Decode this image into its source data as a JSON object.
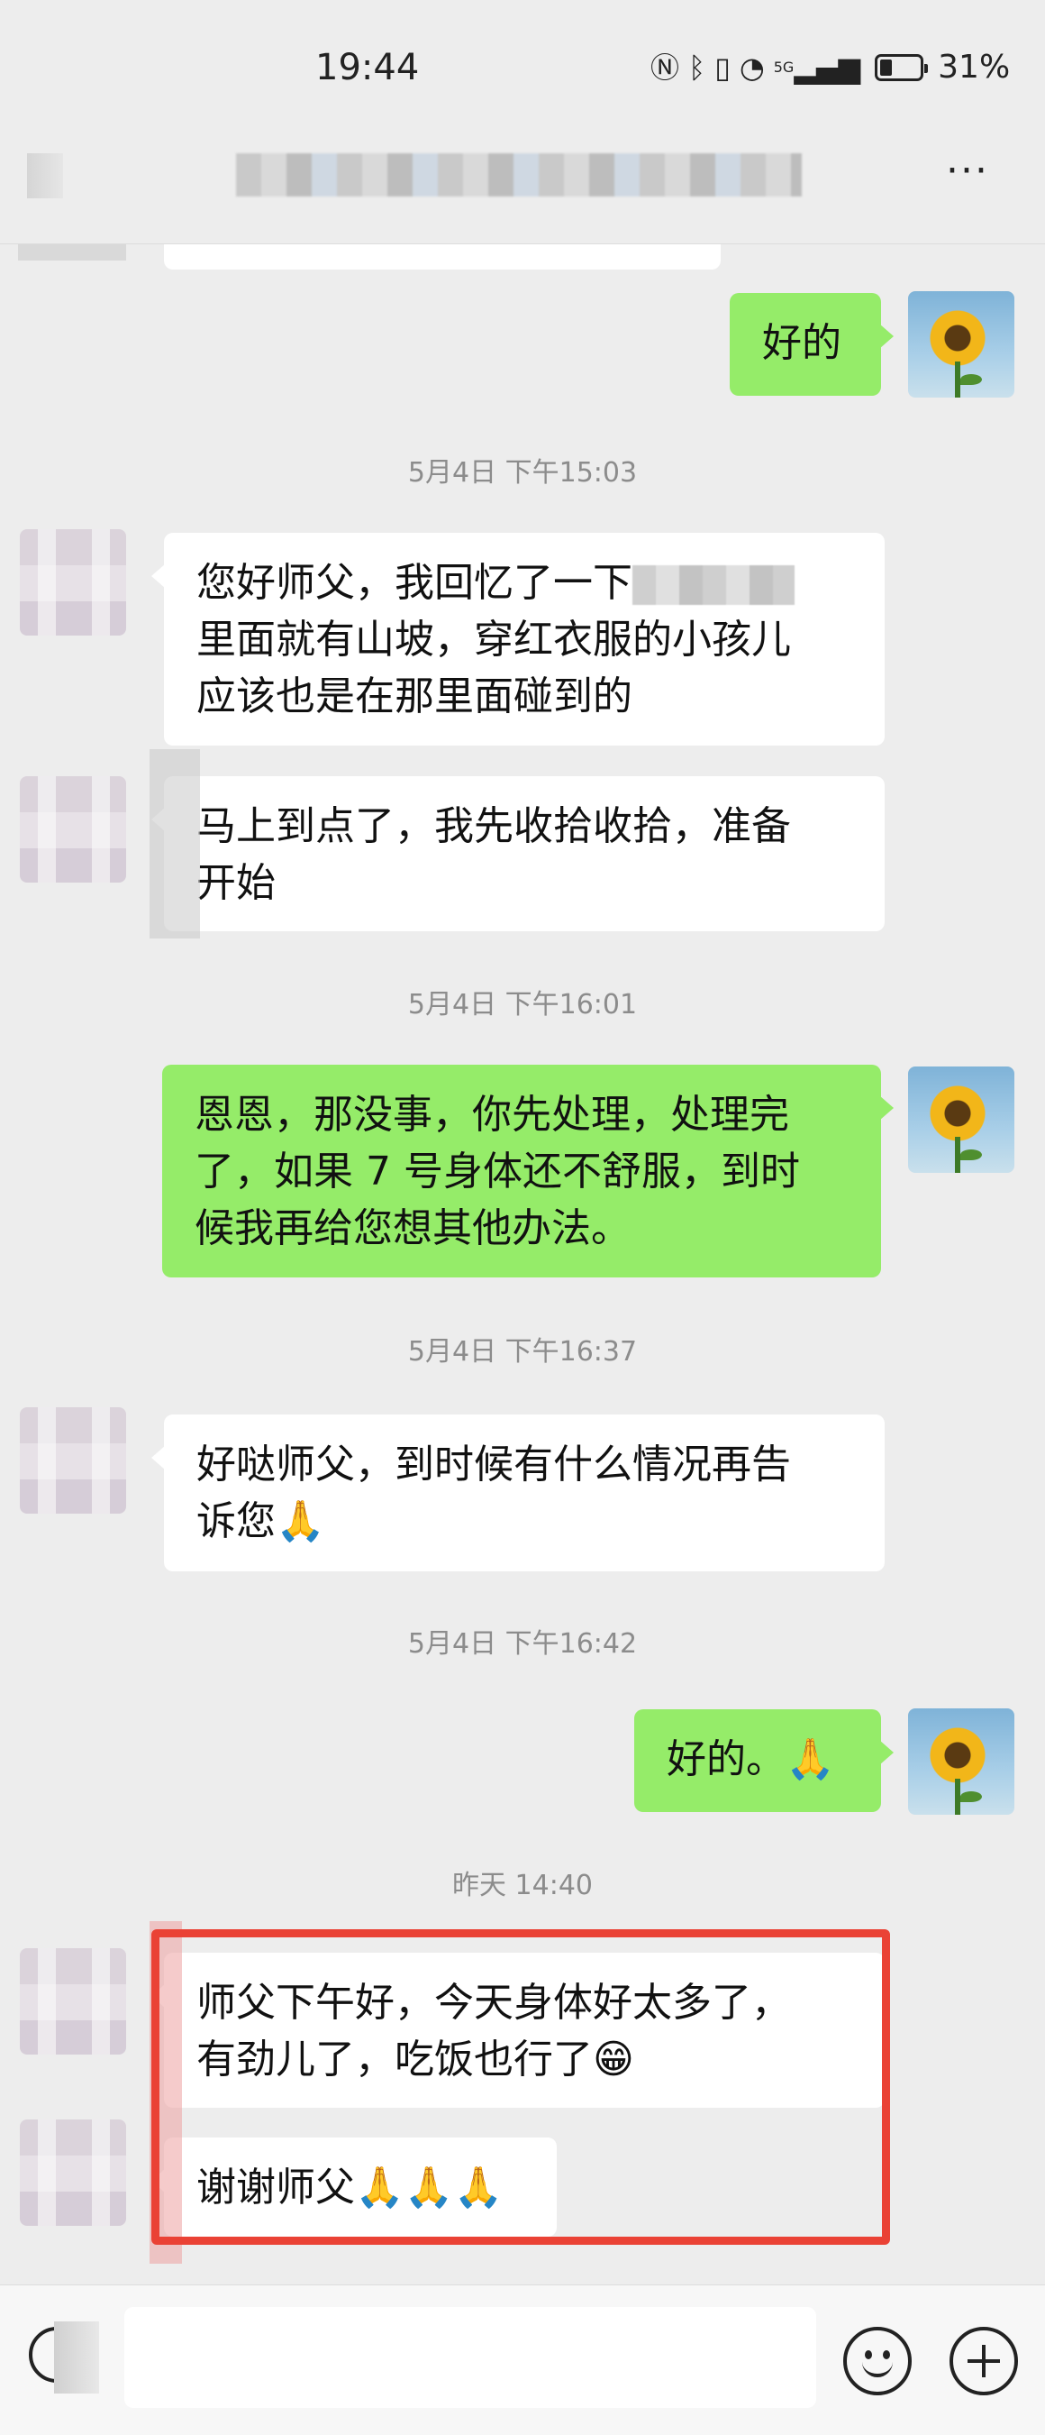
{
  "status_bar": {
    "time": "19:44",
    "icons": [
      "nfc-icon",
      "bluetooth-icon",
      "vibrate-icon",
      "wifi-icon",
      "signal-5g-icon",
      "battery-icon"
    ],
    "network_label": "5G",
    "battery_level": 0.31,
    "battery_text": "31%"
  },
  "nav": {
    "more_label": "···"
  },
  "messages": {
    "m0_text": "好的",
    "ts1": "5月4日 下午15:03",
    "m1_line1": "您好师父，我回忆了一下",
    "m1_line2": "里面就有山坡，穿红衣服的小孩儿",
    "m1_line3": "应该也是在那里面碰到的",
    "m2_line1": "马上到点了，我先收拾收拾，准备",
    "m2_line2": "开始",
    "ts2": "5月4日 下午16:01",
    "m3_line1": "恩恩，那没事，你先处理，处理完",
    "m3_line2": "了，如果 7 号身体还不舒服，到时",
    "m3_line3": "候我再给您想其他办法。",
    "ts3": "5月4日 下午16:37",
    "m4_line1": "好哒师父，到时候有什么情况再告",
    "m4_line2": "诉您🙏",
    "ts4": "5月4日 下午16:42",
    "m5_text": "好的。🙏",
    "ts5": "昨天 14:40",
    "m6_line1": "师父下午好，今天身体好太多了，",
    "m6_line2": "有劲儿了，吃饭也行了😁",
    "m7_text": "谢谢师父🙏🙏🙏"
  },
  "colors": {
    "background": "#ededed",
    "bubble_self": "#95ec69",
    "bubble_other": "#ffffff",
    "highlight_border": "#ea4235",
    "timestamp_text": "#8c8c8c"
  },
  "input_bar": {
    "placeholder": ""
  }
}
